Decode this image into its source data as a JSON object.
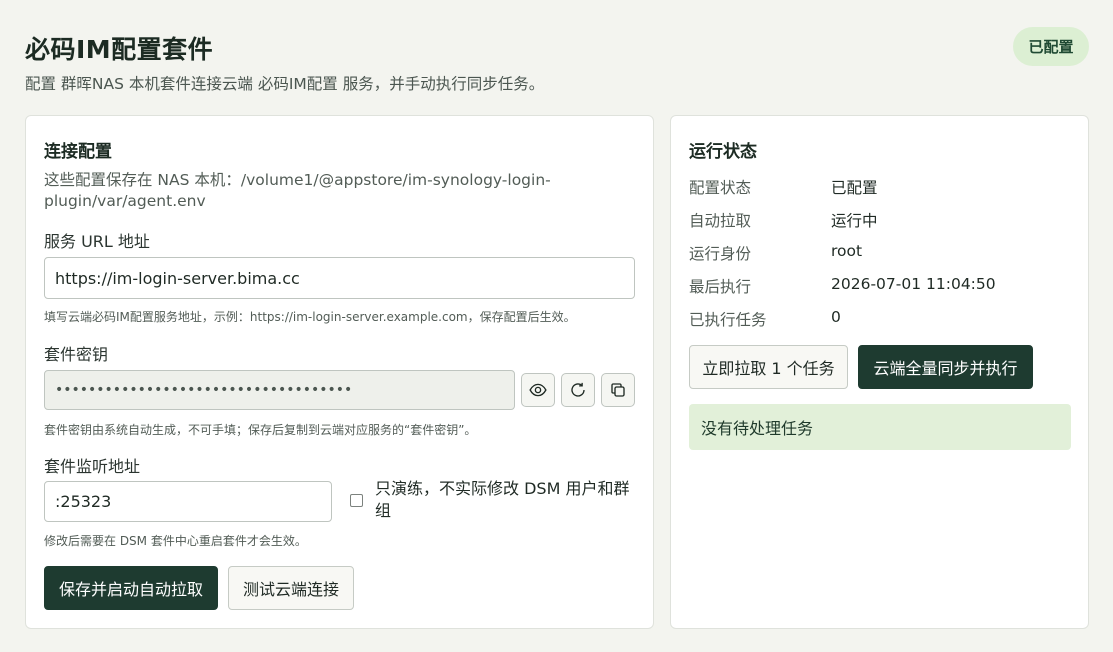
{
  "header": {
    "title": "必码IM配置套件",
    "subtitle": "配置 群晖NAS 本机套件连接云端 必码IM配置 服务，并手动执行同步任务。",
    "badge": "已配置"
  },
  "connection": {
    "title": "连接配置",
    "description": "这些配置保存在 NAS 本机：/volume1/@appstore/im-synology-login-plugin/var/agent.env",
    "url_label": "服务 URL 地址",
    "url_value": "https://im-login-server.bima.cc",
    "url_hint": "填写云端必码IM配置服务地址，示例：https://im-login-server.example.com，保存配置后生效。",
    "key_label": "套件密钥",
    "key_value": "••••••••••••••••••••••••••••••••••••",
    "key_hint": "套件密钥由系统自动生成，不可手填；保存后复制到云端对应服务的“套件密钥”。",
    "listen_label": "套件监听地址",
    "listen_value": ":25323",
    "dry_run_label": "只演练，不实际修改 DSM 用户和群组",
    "dry_run_checked": false,
    "listen_hint": "修改后需要在 DSM 套件中心重启套件才会生效。",
    "save_button": "保存并启动自动拉取",
    "test_button": "测试云端连接"
  },
  "status": {
    "title": "运行状态",
    "rows": [
      {
        "key": "配置状态",
        "value": "已配置"
      },
      {
        "key": "自动拉取",
        "value": "运行中"
      },
      {
        "key": "运行身份",
        "value": "root"
      },
      {
        "key": "最后执行",
        "value": "2026-07-01 11:04:50"
      },
      {
        "key": "已执行任务",
        "value": "0"
      }
    ],
    "pull_button": "立即拉取 1 个任务",
    "sync_button": "云端全量同步并执行",
    "notice": "没有待处理任务"
  },
  "icons": {
    "reveal": "eye-icon",
    "regenerate": "refresh-icon",
    "copy": "copy-icon"
  },
  "colors": {
    "primary": "#1e3b30",
    "badge_bg": "#dcefd3",
    "notice_bg": "#e2f0d9",
    "page_bg": "#f3f4ef"
  }
}
